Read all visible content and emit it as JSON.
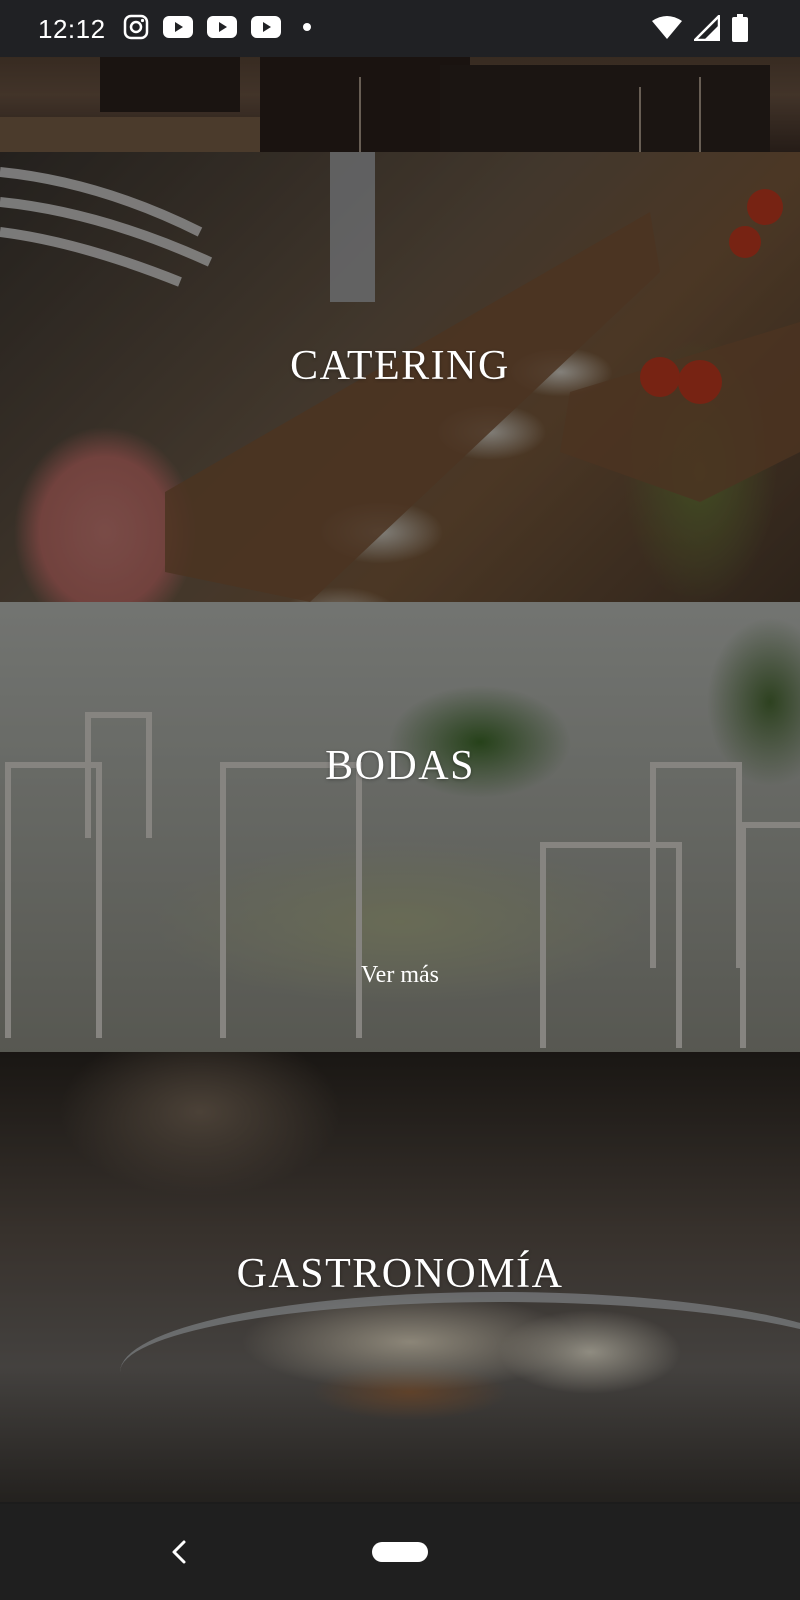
{
  "status_bar": {
    "time": "12:12",
    "notification_icons": [
      "instagram-icon",
      "youtube-icon",
      "youtube-icon",
      "youtube-icon",
      "dot-icon"
    ],
    "system_icons": [
      "wifi-icon",
      "cell-signal-icon",
      "battery-icon"
    ]
  },
  "sections": [
    {
      "id": "top",
      "image": "venue-tables-photo"
    },
    {
      "id": "catering",
      "title": "CATERING",
      "image": "oysters-and-ham-photo"
    },
    {
      "id": "bodas",
      "title": "BODAS",
      "link": "Ver más",
      "image": "wedding-table-photo"
    },
    {
      "id": "gastronomia",
      "title": "GASTRONOMÍA",
      "image": "canapes-photo"
    }
  ],
  "nav": {
    "icons": [
      "back-icon",
      "home-pill"
    ]
  },
  "colors": {
    "status_bar_bg": "#202124",
    "nav_bar_bg": "#1f1f1f",
    "title_text": "#ffffff"
  }
}
